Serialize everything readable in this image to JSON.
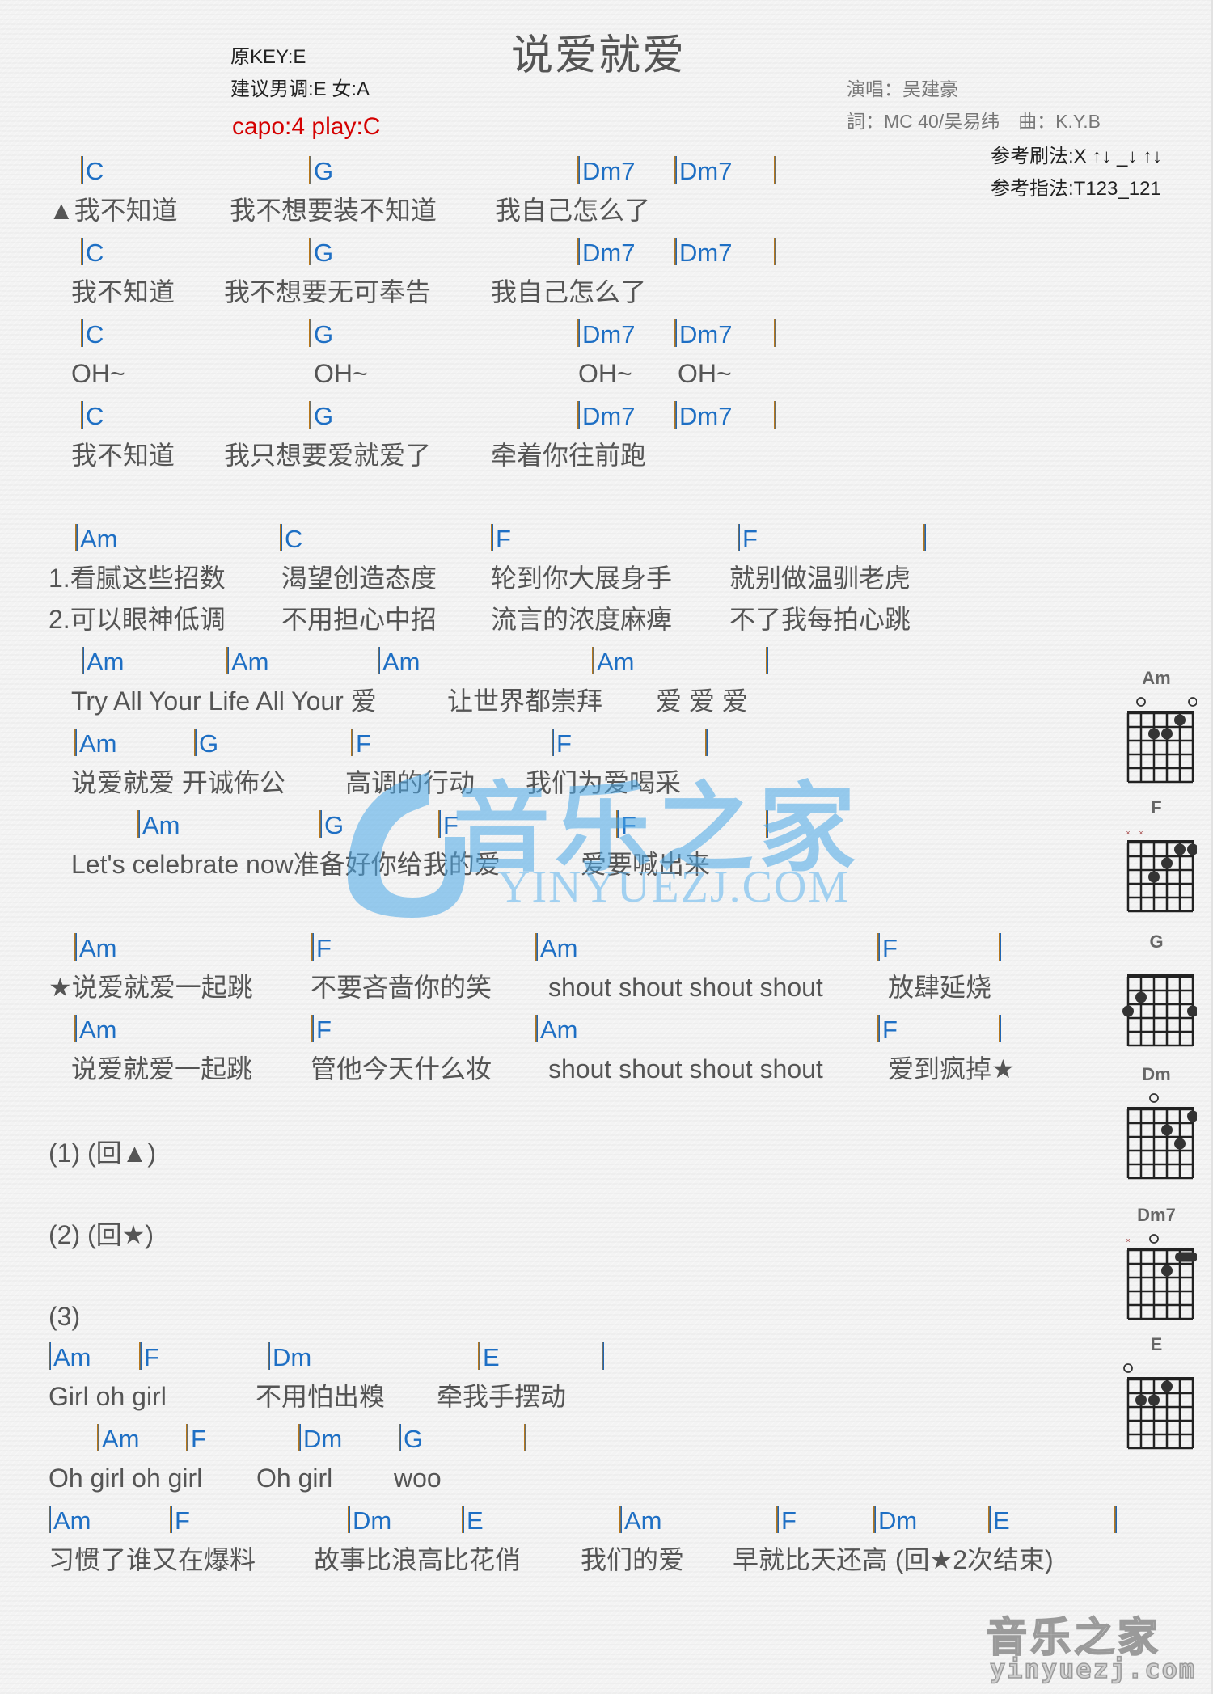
{
  "header": {
    "title": "说爱就爱",
    "original_key": "原KEY:E",
    "suggested_key": "建议男调:E 女:A",
    "capo": "capo:4 play:C",
    "singer": "演唱：吴建豪",
    "lyricist_composer": "詞：MC 40/吴易纬　曲：K.Y.B",
    "strum_pattern": "参考刷法:X ↑↓ _↓ ↑↓",
    "finger_pattern": "参考指法:T123_121"
  },
  "sheet": {
    "lines": [
      {
        "chords": [
          "C",
          "G",
          "Dm7",
          "Dm7",
          ""
        ],
        "lyrics": [
          "▲我不知道",
          "我不想要装不知道",
          "我自己怎么了"
        ]
      },
      {
        "chords": [
          "C",
          "G",
          "Dm7",
          "Dm7",
          ""
        ],
        "lyrics": [
          "我不知道",
          "我不想要无可奉告",
          "我自己怎么了"
        ]
      },
      {
        "chords": [
          "C",
          "G",
          "Dm7",
          "Dm7",
          ""
        ],
        "lyrics": [
          "OH~",
          "OH~",
          "OH~",
          "OH~"
        ]
      },
      {
        "chords": [
          "C",
          "G",
          "Dm7",
          "Dm7",
          ""
        ],
        "lyrics": [
          "我不知道",
          "我只想要爱就爱了",
          "牵着你往前跑"
        ]
      },
      {
        "chords": [
          "Am",
          "C",
          "F",
          "F",
          ""
        ],
        "lyrics": [
          "1.看腻这些招数",
          "渴望创造态度",
          "轮到你大展身手",
          "就别做温驯老虎"
        ],
        "lyrics2": [
          "2.可以眼神低调",
          "不用担心中招",
          "流言的浓度麻痺",
          "不了我每拍心跳"
        ]
      },
      {
        "chords": [
          "Am",
          "Am",
          "Am",
          "Am",
          ""
        ],
        "lyrics": [
          "Try All Your Life All Your 爱",
          "让世界都崇拜",
          "爱 爱 爱"
        ]
      },
      {
        "chords": [
          "Am",
          "G",
          "F",
          "F",
          ""
        ],
        "lyrics": [
          "说爱就爱 开诚佈公",
          "高调的行动",
          "我们为爱喝采"
        ]
      },
      {
        "chords": [
          "Am",
          "G",
          "F",
          "F",
          ""
        ],
        "lyrics": [
          "Let's celebrate now准备好你给我的爱",
          "爱要喊出来"
        ]
      },
      {
        "chords": [
          "Am",
          "F",
          "Am",
          "F",
          ""
        ],
        "lyrics": [
          "★说爱就爱一起跳",
          "不要吝啬你的笑",
          "shout shout shout shout",
          "放肆延烧"
        ]
      },
      {
        "chords": [
          "Am",
          "F",
          "Am",
          "F",
          ""
        ],
        "lyrics": [
          "说爱就爱一起跳",
          "管他今天什么妆",
          "shout shout shout shout",
          "爱到疯掉★"
        ]
      },
      {
        "chords": [
          "Am",
          "F",
          "Dm",
          "E",
          ""
        ],
        "lyrics": [
          "Girl oh girl",
          "不用怕出糗",
          "牵我手摆动"
        ]
      },
      {
        "chords": [
          "Am",
          "F",
          "Dm",
          "G",
          ""
        ],
        "lyrics": [
          "Oh girl oh girl",
          "Oh girl",
          "woo"
        ]
      },
      {
        "chords": [
          "Am",
          "F",
          "Dm",
          "E",
          "Am",
          "F",
          "Dm",
          "E",
          ""
        ],
        "lyrics": [
          "习惯了谁又在爆料",
          "故事比浪高比花俏",
          "我们的爱",
          "早就比天还高 (回★2次结束)"
        ]
      }
    ],
    "notes": [
      "(1) (回▲)",
      "(2) (回★)",
      "(3)"
    ]
  },
  "chord_diagrams": [
    {
      "name": "Am",
      "open": [
        1,
        5
      ],
      "muted": [],
      "dots": [
        [
          4,
          1
        ],
        [
          2,
          2
        ],
        [
          3,
          2
        ]
      ],
      "barre": null
    },
    {
      "name": "F",
      "open": [],
      "muted": [
        0,
        1
      ],
      "dots": [
        [
          4,
          1
        ],
        [
          5,
          1
        ],
        [
          3,
          2
        ],
        [
          2,
          3
        ]
      ],
      "barre": null
    },
    {
      "name": "G",
      "open": [],
      "muted": [],
      "dots": [
        [
          1,
          2
        ],
        [
          0,
          3
        ],
        [
          5,
          3
        ]
      ],
      "barre": null
    },
    {
      "name": "Dm",
      "open": [
        2
      ],
      "muted": [],
      "dots": [
        [
          5,
          1
        ],
        [
          3,
          2
        ],
        [
          4,
          3
        ]
      ],
      "barre": null
    },
    {
      "name": "Dm7",
      "open": [
        2
      ],
      "muted": [
        0
      ],
      "dots": [
        [
          3,
          2
        ]
      ],
      "barre": [
        4,
        5,
        1
      ]
    },
    {
      "name": "E",
      "open": [
        0
      ],
      "muted": [],
      "dots": [
        [
          3,
          1
        ],
        [
          1,
          2
        ],
        [
          2,
          2
        ]
      ],
      "barre": null
    }
  ],
  "watermark": {
    "cn": "音乐之家",
    "en": "YINYUEZJ.COM"
  },
  "logo": {
    "cn": "音乐之家",
    "en": "yinyuezj.com"
  },
  "colors": {
    "chord": "#1e6fc4",
    "capo": "#d40000",
    "bar_left": "#b8781c",
    "bar_right": "#2166b3",
    "watermark": "#4aa8e8"
  }
}
